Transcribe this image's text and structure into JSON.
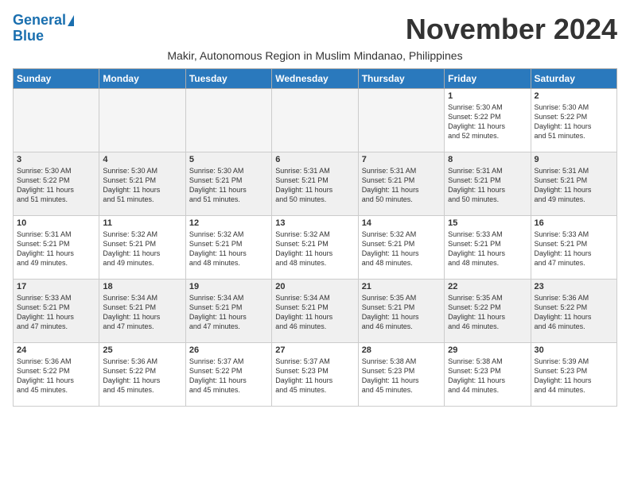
{
  "header": {
    "logo_line1": "General",
    "logo_line2": "Blue",
    "month": "November 2024",
    "subtitle": "Makir, Autonomous Region in Muslim Mindanao, Philippines"
  },
  "weekdays": [
    "Sunday",
    "Monday",
    "Tuesday",
    "Wednesday",
    "Thursday",
    "Friday",
    "Saturday"
  ],
  "weeks": [
    [
      {
        "day": "",
        "info": ""
      },
      {
        "day": "",
        "info": ""
      },
      {
        "day": "",
        "info": ""
      },
      {
        "day": "",
        "info": ""
      },
      {
        "day": "",
        "info": ""
      },
      {
        "day": "1",
        "info": "Sunrise: 5:30 AM\nSunset: 5:22 PM\nDaylight: 11 hours\nand 52 minutes."
      },
      {
        "day": "2",
        "info": "Sunrise: 5:30 AM\nSunset: 5:22 PM\nDaylight: 11 hours\nand 51 minutes."
      }
    ],
    [
      {
        "day": "3",
        "info": "Sunrise: 5:30 AM\nSunset: 5:22 PM\nDaylight: 11 hours\nand 51 minutes."
      },
      {
        "day": "4",
        "info": "Sunrise: 5:30 AM\nSunset: 5:21 PM\nDaylight: 11 hours\nand 51 minutes."
      },
      {
        "day": "5",
        "info": "Sunrise: 5:30 AM\nSunset: 5:21 PM\nDaylight: 11 hours\nand 51 minutes."
      },
      {
        "day": "6",
        "info": "Sunrise: 5:31 AM\nSunset: 5:21 PM\nDaylight: 11 hours\nand 50 minutes."
      },
      {
        "day": "7",
        "info": "Sunrise: 5:31 AM\nSunset: 5:21 PM\nDaylight: 11 hours\nand 50 minutes."
      },
      {
        "day": "8",
        "info": "Sunrise: 5:31 AM\nSunset: 5:21 PM\nDaylight: 11 hours\nand 50 minutes."
      },
      {
        "day": "9",
        "info": "Sunrise: 5:31 AM\nSunset: 5:21 PM\nDaylight: 11 hours\nand 49 minutes."
      }
    ],
    [
      {
        "day": "10",
        "info": "Sunrise: 5:31 AM\nSunset: 5:21 PM\nDaylight: 11 hours\nand 49 minutes."
      },
      {
        "day": "11",
        "info": "Sunrise: 5:32 AM\nSunset: 5:21 PM\nDaylight: 11 hours\nand 49 minutes."
      },
      {
        "day": "12",
        "info": "Sunrise: 5:32 AM\nSunset: 5:21 PM\nDaylight: 11 hours\nand 48 minutes."
      },
      {
        "day": "13",
        "info": "Sunrise: 5:32 AM\nSunset: 5:21 PM\nDaylight: 11 hours\nand 48 minutes."
      },
      {
        "day": "14",
        "info": "Sunrise: 5:32 AM\nSunset: 5:21 PM\nDaylight: 11 hours\nand 48 minutes."
      },
      {
        "day": "15",
        "info": "Sunrise: 5:33 AM\nSunset: 5:21 PM\nDaylight: 11 hours\nand 48 minutes."
      },
      {
        "day": "16",
        "info": "Sunrise: 5:33 AM\nSunset: 5:21 PM\nDaylight: 11 hours\nand 47 minutes."
      }
    ],
    [
      {
        "day": "17",
        "info": "Sunrise: 5:33 AM\nSunset: 5:21 PM\nDaylight: 11 hours\nand 47 minutes."
      },
      {
        "day": "18",
        "info": "Sunrise: 5:34 AM\nSunset: 5:21 PM\nDaylight: 11 hours\nand 47 minutes."
      },
      {
        "day": "19",
        "info": "Sunrise: 5:34 AM\nSunset: 5:21 PM\nDaylight: 11 hours\nand 47 minutes."
      },
      {
        "day": "20",
        "info": "Sunrise: 5:34 AM\nSunset: 5:21 PM\nDaylight: 11 hours\nand 46 minutes."
      },
      {
        "day": "21",
        "info": "Sunrise: 5:35 AM\nSunset: 5:21 PM\nDaylight: 11 hours\nand 46 minutes."
      },
      {
        "day": "22",
        "info": "Sunrise: 5:35 AM\nSunset: 5:22 PM\nDaylight: 11 hours\nand 46 minutes."
      },
      {
        "day": "23",
        "info": "Sunrise: 5:36 AM\nSunset: 5:22 PM\nDaylight: 11 hours\nand 46 minutes."
      }
    ],
    [
      {
        "day": "24",
        "info": "Sunrise: 5:36 AM\nSunset: 5:22 PM\nDaylight: 11 hours\nand 45 minutes."
      },
      {
        "day": "25",
        "info": "Sunrise: 5:36 AM\nSunset: 5:22 PM\nDaylight: 11 hours\nand 45 minutes."
      },
      {
        "day": "26",
        "info": "Sunrise: 5:37 AM\nSunset: 5:22 PM\nDaylight: 11 hours\nand 45 minutes."
      },
      {
        "day": "27",
        "info": "Sunrise: 5:37 AM\nSunset: 5:23 PM\nDaylight: 11 hours\nand 45 minutes."
      },
      {
        "day": "28",
        "info": "Sunrise: 5:38 AM\nSunset: 5:23 PM\nDaylight: 11 hours\nand 45 minutes."
      },
      {
        "day": "29",
        "info": "Sunrise: 5:38 AM\nSunset: 5:23 PM\nDaylight: 11 hours\nand 44 minutes."
      },
      {
        "day": "30",
        "info": "Sunrise: 5:39 AM\nSunset: 5:23 PM\nDaylight: 11 hours\nand 44 minutes."
      }
    ]
  ]
}
